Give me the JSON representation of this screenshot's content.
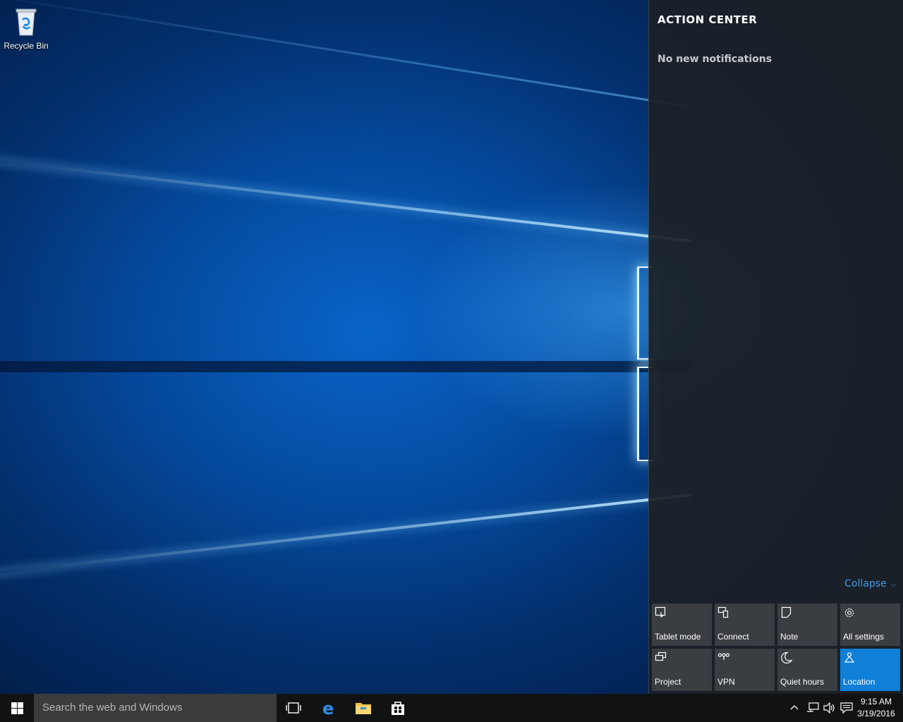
{
  "desktop": {
    "icons": [
      {
        "label": "Recycle Bin",
        "icon": "recycle-bin-icon"
      }
    ]
  },
  "action_center": {
    "title": "ACTION CENTER",
    "empty_message": "No new notifications",
    "collapse_label": "Collapse",
    "accent_color": "#0f7fd8",
    "quick_actions": [
      {
        "label": "Tablet mode",
        "icon": "tablet-mode-icon",
        "active": false
      },
      {
        "label": "Connect",
        "icon": "connect-icon",
        "active": false
      },
      {
        "label": "Note",
        "icon": "note-icon",
        "active": false
      },
      {
        "label": "All settings",
        "icon": "gear-icon",
        "active": false
      },
      {
        "label": "Project",
        "icon": "project-icon",
        "active": false
      },
      {
        "label": "VPN",
        "icon": "vpn-icon",
        "active": false
      },
      {
        "label": "Quiet hours",
        "icon": "moon-icon",
        "active": false
      },
      {
        "label": "Location",
        "icon": "location-icon",
        "active": true
      }
    ]
  },
  "taskbar": {
    "search_placeholder": "Search the web and Windows",
    "pinned": [
      "task-view-icon",
      "edge-icon",
      "file-explorer-icon",
      "store-icon"
    ],
    "tray_icons": [
      "chevron-up-icon",
      "network-icon",
      "volume-icon",
      "action-center-icon"
    ],
    "clock": {
      "time": "9:15 AM",
      "date": "3/19/2016"
    }
  }
}
